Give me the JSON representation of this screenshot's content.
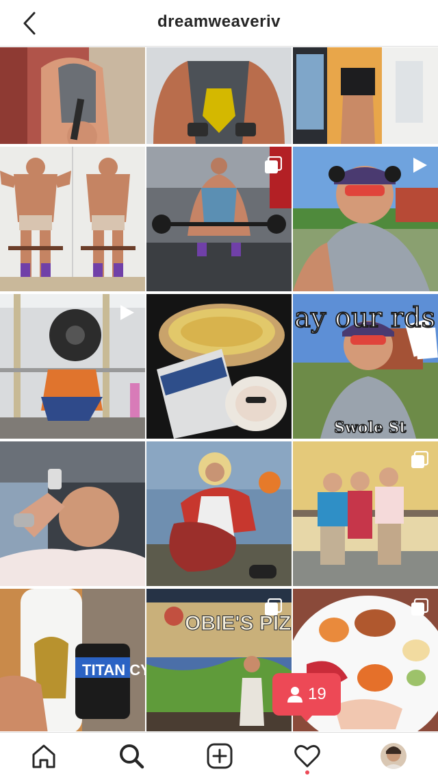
{
  "header": {
    "username": "dreamweaveriv"
  },
  "tiles": [
    {
      "text": ""
    },
    {
      "text": ""
    },
    {
      "text": ""
    },
    {
      "text": ""
    },
    {
      "text": ""
    },
    {
      "text": ""
    },
    {
      "text": ""
    },
    {
      "text": ""
    },
    {
      "text": "ay our rds",
      "caption": "Swole St"
    },
    {
      "text": ""
    },
    {
      "text": ""
    },
    {
      "text": ""
    },
    {
      "text": "TITAN CYNERA"
    },
    {
      "text": "OBIE'S PIZZA"
    },
    {
      "text": ""
    }
  ],
  "notification": {
    "count": "19"
  },
  "colors": {
    "notification": "#ed4956",
    "border": "#dbdbdb",
    "text": "#262626"
  }
}
